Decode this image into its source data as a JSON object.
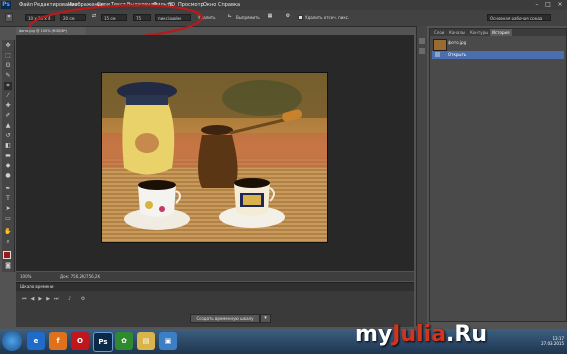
{
  "menu": {
    "logo": "Ps",
    "items": [
      "Файл",
      "Редактирование",
      "Изображение",
      "Слои",
      "Текст",
      "Выделение",
      "Фильтр",
      "3D",
      "Просмотр",
      "Окно",
      "Справка"
    ],
    "window_controls": [
      "–",
      "□",
      "×"
    ]
  },
  "options": {
    "ratio_value": "10 x 15 x 4",
    "width_value": "20 см",
    "height_value": "15 см",
    "resolution_value": "75",
    "resolution_unit": "пикс/дюйм",
    "clear_label": "Удалить",
    "straighten_label": "Выпрямить",
    "delete_cropped_label": "Удалить отсеч. пикс.",
    "workspace_value": "Основная рабочая среда"
  },
  "document": {
    "tab_label": "фото.jpg @ 100% (RGB/8*)",
    "zoom": "100%",
    "doc_info": "Док: 756,2K/756,2K"
  },
  "timeline": {
    "title": "Шкала времени",
    "create_button": "Создать временную шкалу"
  },
  "panels": {
    "tabs": [
      "Слои",
      "Каналы",
      "Контуры",
      "История"
    ],
    "active_tab": "История",
    "snapshot_label": "фото.jpg",
    "history_item": "Открыть"
  },
  "colors": {
    "menu_bg": "#3c3c3c",
    "foreground": "#a01818",
    "background": "#ffffff",
    "selection": "#4b6eaf"
  },
  "watermark": {
    "part1": "my",
    "part2": "Julia",
    "part3": ".Ru"
  },
  "taskbar": {
    "apps": [
      {
        "icon": "ie-icon",
        "text": "e",
        "color": "#1f6bc7"
      },
      {
        "icon": "firefox-icon",
        "text": "f",
        "color": "#e0711c"
      },
      {
        "icon": "opera-icon",
        "text": "O",
        "color": "#c0161e"
      },
      {
        "icon": "photoshop-icon",
        "text": "Ps",
        "color": "#0b2a4a"
      },
      {
        "icon": "icq-icon",
        "text": "✿",
        "color": "#2f8a2f"
      },
      {
        "icon": "explorer-icon",
        "text": "▤",
        "color": "#d9b44a"
      },
      {
        "icon": "picture-viewer-icon",
        "text": "▣",
        "color": "#3c7fc4"
      }
    ],
    "clock_time": "13:17",
    "clock_date": "27.03.2015"
  }
}
